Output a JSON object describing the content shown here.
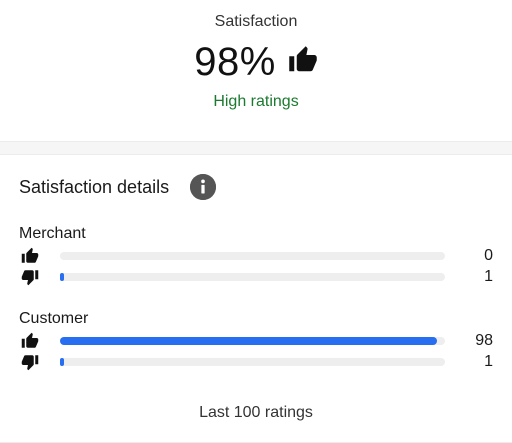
{
  "summary": {
    "label": "Satisfaction",
    "percentage": "98%",
    "rating_word": "High ratings"
  },
  "details": {
    "title": "Satisfaction details",
    "groups": [
      {
        "label": "Merchant",
        "positive": {
          "count": "0",
          "fraction": 0.0
        },
        "negative": {
          "count": "1",
          "fraction": 0.01
        }
      },
      {
        "label": "Customer",
        "positive": {
          "count": "98",
          "fraction": 0.98
        },
        "negative": {
          "count": "1",
          "fraction": 0.01
        }
      }
    ],
    "footer": "Last 100 ratings"
  },
  "colors": {
    "accent_bar": "#276ef1",
    "positive_text": "#1b7a2f",
    "track": "#eeeeee"
  },
  "icons": {
    "thumb_up": "thumbs-up-icon",
    "thumb_down": "thumbs-down-icon",
    "info": "info-icon"
  }
}
